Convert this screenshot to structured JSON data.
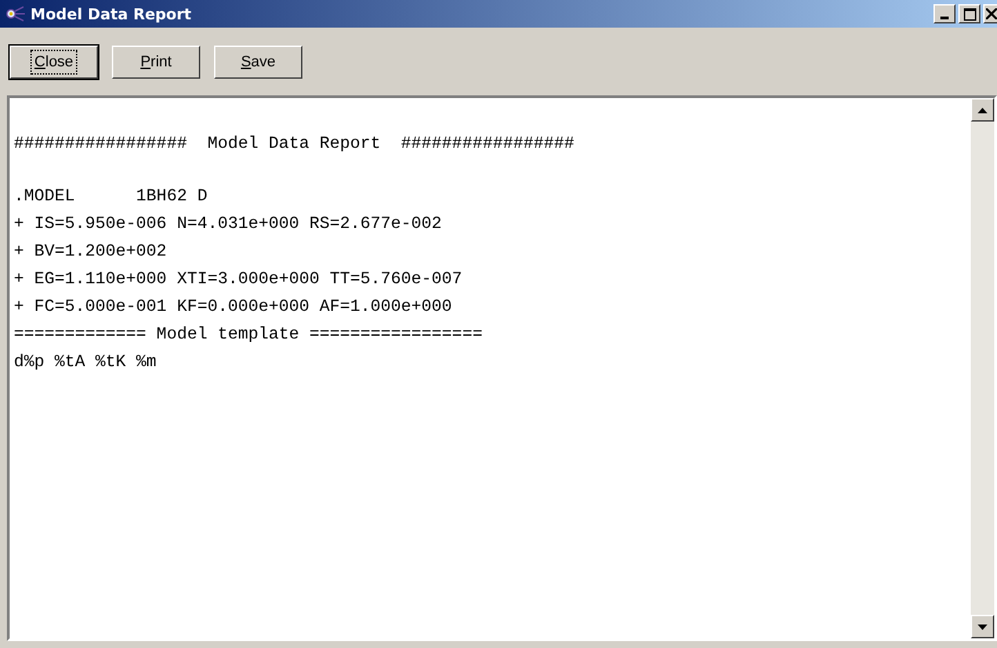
{
  "window": {
    "title": "Model Data Report"
  },
  "buttons": [
    {
      "label": "Close",
      "default": true
    },
    {
      "label": "Print",
      "default": false
    },
    {
      "label": "Save",
      "default": false
    }
  ],
  "report_blocks": [
    [
      "#################  Model Data Report  #################"
    ],
    [
      ".MODEL      1BH62 D",
      "+ IS=5.950e-006 N=4.031e+000 RS=2.677e-002",
      "+ BV=1.200e+002",
      "+ EG=1.110e+000 XTI=3.000e+000 TT=5.760e-007",
      "+ FC=5.000e-001 KF=0.000e+000 AF=1.000e+000",
      "============= Model template =================",
      "d%p %tA %tK %m"
    ]
  ]
}
